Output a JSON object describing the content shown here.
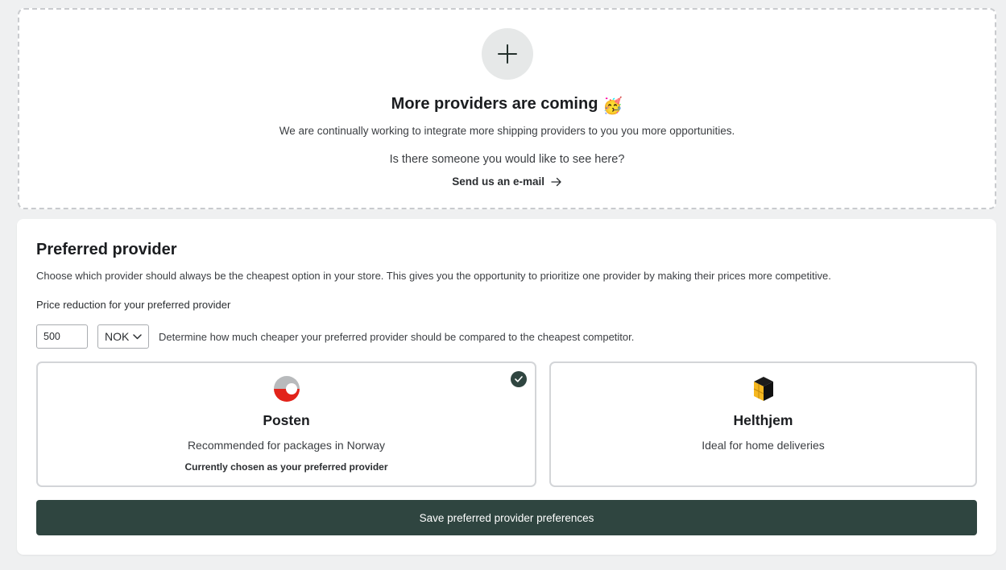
{
  "coming": {
    "title": "More providers are coming",
    "emoji": "🥳",
    "description": "We are continually working to integrate more shipping providers to you you more opportunities.",
    "question": "Is there someone you would like to see here?",
    "email_link": "Send us an e-mail",
    "icons": {
      "plus": "plus-icon",
      "arrow": "arrow-right-icon",
      "party": "party-face-icon"
    }
  },
  "preferred": {
    "title": "Preferred provider",
    "description": "Choose which provider should always be the cheapest option in your store. This gives you the opportunity to prioritize one provider by making their prices more competitive.",
    "price_label": "Price reduction for your preferred provider",
    "amount_value": "500",
    "currency": "NOK",
    "amount_help": "Determine how much cheaper your preferred provider should be compared to the cheapest competitor.",
    "providers": [
      {
        "name": "Posten",
        "description": "Recommended for packages in Norway",
        "note": "Currently chosen as your preferred provider",
        "selected": true,
        "icon": "posten-logo"
      },
      {
        "name": "Helthjem",
        "description": "Ideal for home deliveries",
        "selected": false,
        "icon": "helthjem-logo"
      }
    ],
    "save_label": "Save preferred provider preferences"
  },
  "colors": {
    "accent": "#2f4540",
    "posten_red": "#e2231a",
    "helthjem_yellow": "#f6b820",
    "page_bg": "#eff0f1"
  }
}
